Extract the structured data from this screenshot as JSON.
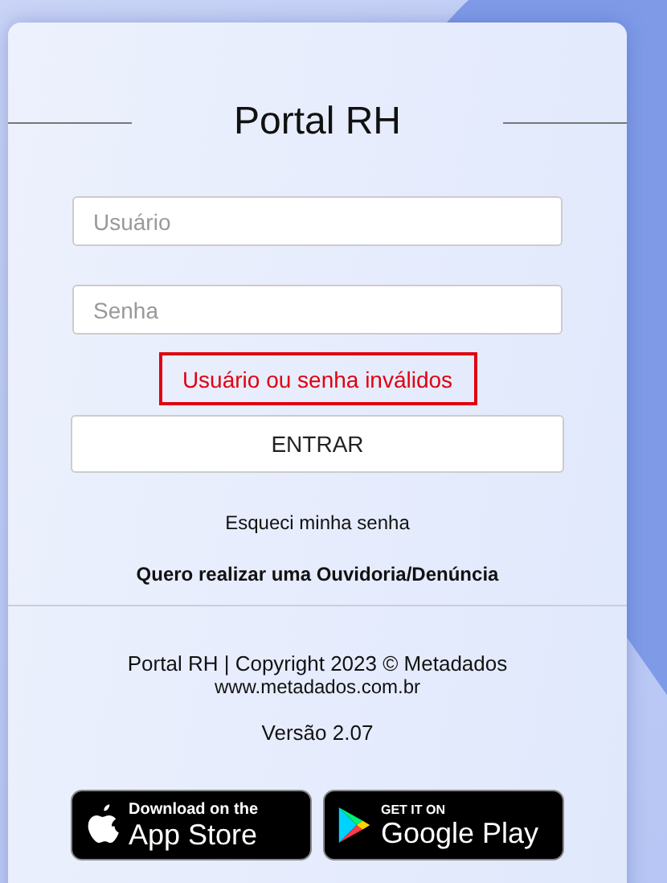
{
  "title": "Portal RH",
  "fields": [
    {
      "placeholder": "Usuário"
    },
    {
      "placeholder": "Senha"
    }
  ],
  "error": "Usuário ou senha inválidos",
  "login_button": "ENTRAR",
  "forgot_link": "Esqueci minha senha",
  "ombudsman_link": "Quero realizar uma Ouvidoria/Denúncia",
  "footer": {
    "copyright": "Portal RH | Copyright 2023 © Metadados",
    "url": "www.metadados.com.br",
    "version": "Versão 2.07"
  },
  "badges": [
    {
      "kind": "apple",
      "small": "Download on the",
      "big": "App Store"
    },
    {
      "kind": "google",
      "small": "GET IT ON",
      "big": "Google Play"
    }
  ]
}
